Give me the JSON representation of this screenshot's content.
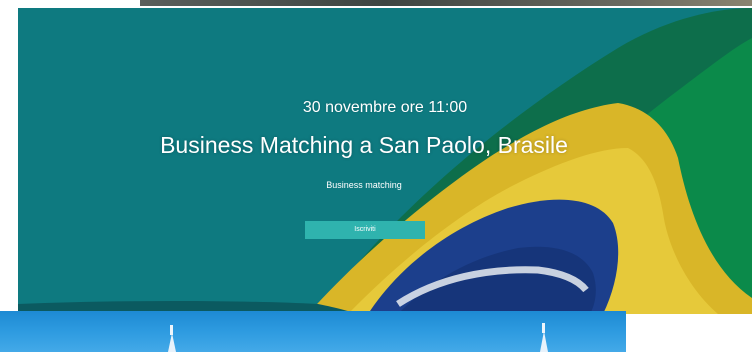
{
  "event": {
    "date_time": "30 novembre ore 11:00",
    "title": "Business Matching a San Paolo, Brasile",
    "category": "Business matching",
    "cta_label": "Iscriviti"
  },
  "colors": {
    "hero_overlay": "#0e7a80",
    "button": "#2fb3ae",
    "flag_green": "#0b8a4a",
    "flag_yellow": "#e3c32a",
    "flag_blue": "#1c3f8c",
    "sky_blue": "#2e9be0"
  }
}
